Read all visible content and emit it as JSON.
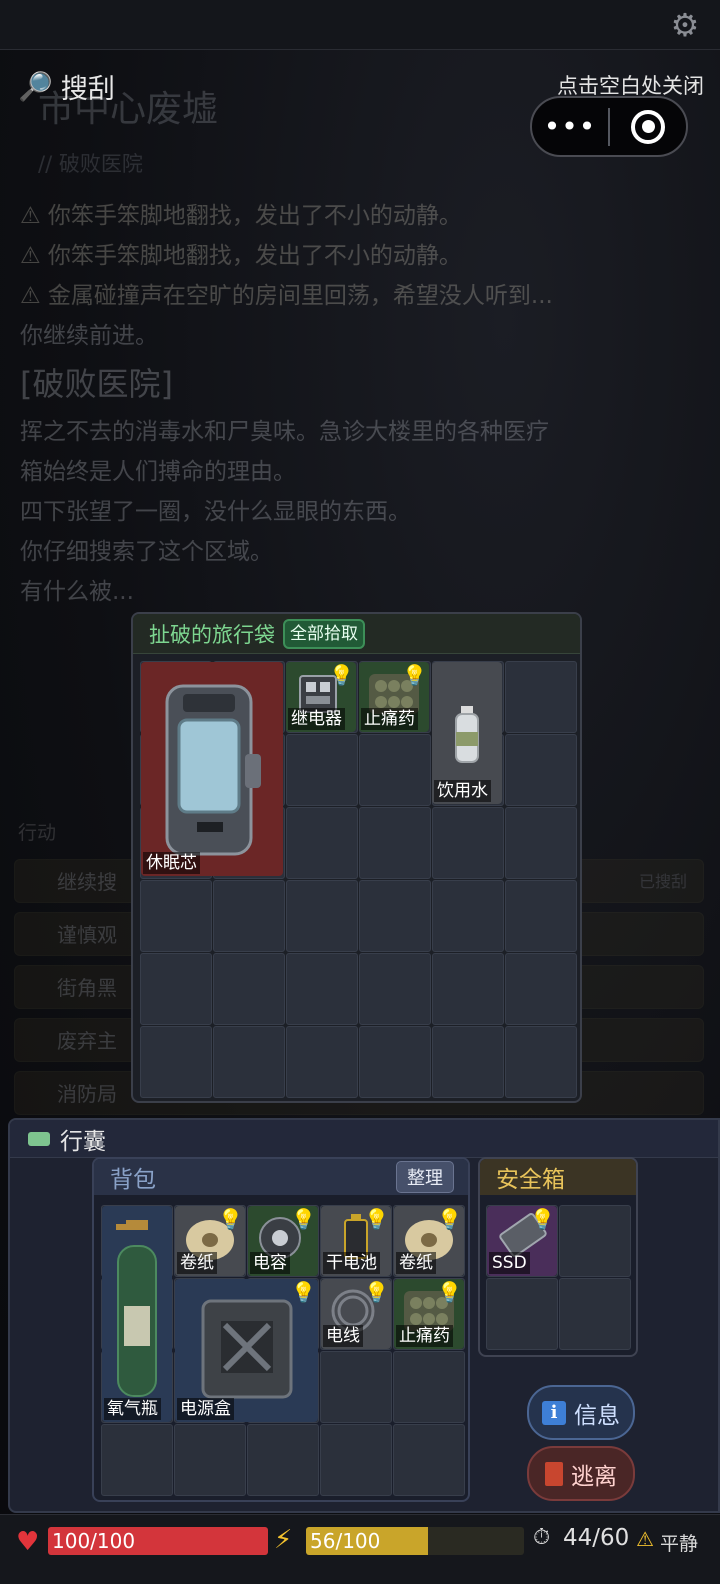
{
  "topbar": {
    "settings_icon": "gear-icon"
  },
  "background_log": {
    "location_title": "市中心废墟",
    "sublocation": "// 破败医院",
    "lines": [
      "⚠ 你笨手笨脚地翻找，发出了不小的动静。",
      "⚠ 你笨手笨脚地翻找，发出了不小的动静。",
      "⚠ 金属碰撞声在空旷的房间里回荡，希望没人听到...",
      "你继续前进。"
    ],
    "area_name": "[破败医院]",
    "description": [
      "挥之不去的消毒水和尸臭味。急诊大楼里的各种医疗",
      "箱始终是人们搏命的理由。",
      "四下张望了一圈，没什么显眼的东西。",
      "你仔细搜索了这个区域。",
      "有什么被..."
    ],
    "actions_label": "行动",
    "actions": [
      "继续搜",
      "谨慎观",
      "街角黑",
      "废弃主",
      "消防局"
    ],
    "action_badge": "已搜刮"
  },
  "search_header": {
    "icon": "magnifier-icon",
    "title": "搜刮",
    "close_hint": "点击空白处关闭"
  },
  "capsule": {
    "more_icon": "more-dots-icon",
    "close_icon": "target-icon"
  },
  "loot": {
    "title": "扯破的旅行袋",
    "take_all": "全部拾取",
    "items": [
      {
        "name": "休眠芯",
        "icon": "cryo-core-icon",
        "color": "#6b2626"
      },
      {
        "name": "继电器",
        "icon": "relay-icon",
        "color": "#2c4a2e"
      },
      {
        "name": "止痛药",
        "icon": "painkiller-icon",
        "color": "#2c4a2e"
      },
      {
        "name": "饮用水",
        "icon": "water-bottle-icon",
        "color": "#474a50"
      }
    ]
  },
  "inventory": {
    "title": "行囊",
    "backpack": {
      "title": "背包",
      "sort_label": "整理",
      "items": [
        {
          "name": "氧气瓶",
          "icon": "oxygen-tank-icon",
          "color": "#2a3a55"
        },
        {
          "name": "卷纸",
          "icon": "toilet-paper-icon",
          "color": "#474a50"
        },
        {
          "name": "电容",
          "icon": "capacitor-icon",
          "color": "#2c4a2e"
        },
        {
          "name": "干电池",
          "icon": "battery-icon",
          "color": "#474a50"
        },
        {
          "name": "卷纸",
          "icon": "toilet-paper-icon",
          "color": "#474a50"
        },
        {
          "name": "电源盒",
          "icon": "power-box-icon",
          "color": "#2a3a55"
        },
        {
          "name": "电线",
          "icon": "wire-icon",
          "color": "#474a50"
        },
        {
          "name": "止痛药",
          "icon": "painkiller-icon",
          "color": "#2c4a2e"
        }
      ]
    },
    "safebox": {
      "title": "安全箱",
      "items": [
        {
          "name": "SSD",
          "icon": "ssd-icon",
          "color": "#4a2e5a"
        }
      ]
    }
  },
  "buttons": {
    "info": "信息",
    "escape": "逃离"
  },
  "status": {
    "hp": "100/100",
    "hp_value": 100,
    "hp_max": 100,
    "energy": "56/100",
    "energy_value": 56,
    "energy_max": 100,
    "time": "44/60",
    "state": "平静",
    "colors": {
      "hp": "#d3353b",
      "energy": "#c9a52a"
    }
  }
}
